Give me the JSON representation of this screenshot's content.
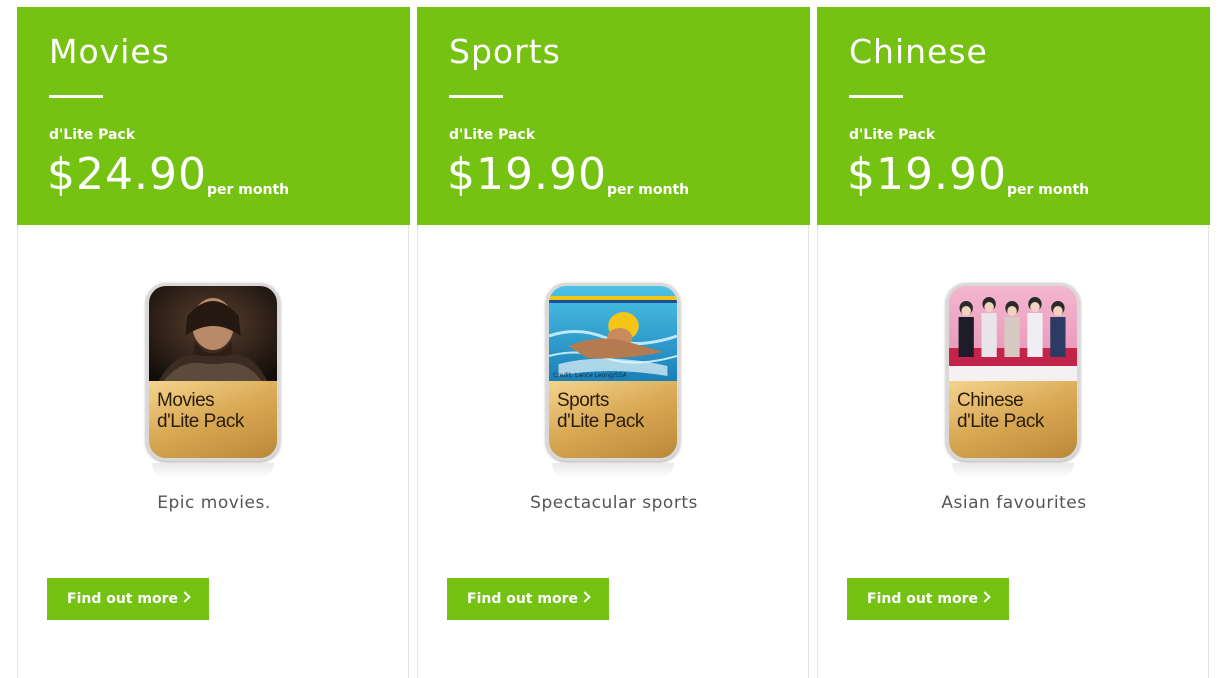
{
  "colors": {
    "accent": "#76c213",
    "text": "#555555",
    "border": "#e3e3e3"
  },
  "cards": [
    {
      "title": "Movies",
      "pack_label": "d'Lite Pack",
      "price": "$24.90",
      "per": "per month",
      "tile_label_line1": "Movies",
      "tile_label_line2": "d'Lite Pack",
      "tile_credit": "",
      "icon": "movies-pack-icon",
      "description": "Epic movies.",
      "button": "Find out more"
    },
    {
      "title": "Sports",
      "pack_label": "d'Lite Pack",
      "price": "$19.90",
      "per": "per month",
      "tile_label_line1": "Sports",
      "tile_label_line2": "d'Lite Pack",
      "tile_credit": "Credit: Lance Leong/SSA",
      "icon": "sports-pack-icon",
      "description": "Spectacular sports",
      "button": "Find out more"
    },
    {
      "title": "Chinese",
      "pack_label": "d'Lite Pack",
      "price": "$19.90",
      "per": "per month",
      "tile_label_line1": "Chinese",
      "tile_label_line2": "d'Lite Pack",
      "tile_credit": "",
      "icon": "chinese-pack-icon",
      "description": "Asian favourites",
      "button": "Find out more"
    }
  ]
}
